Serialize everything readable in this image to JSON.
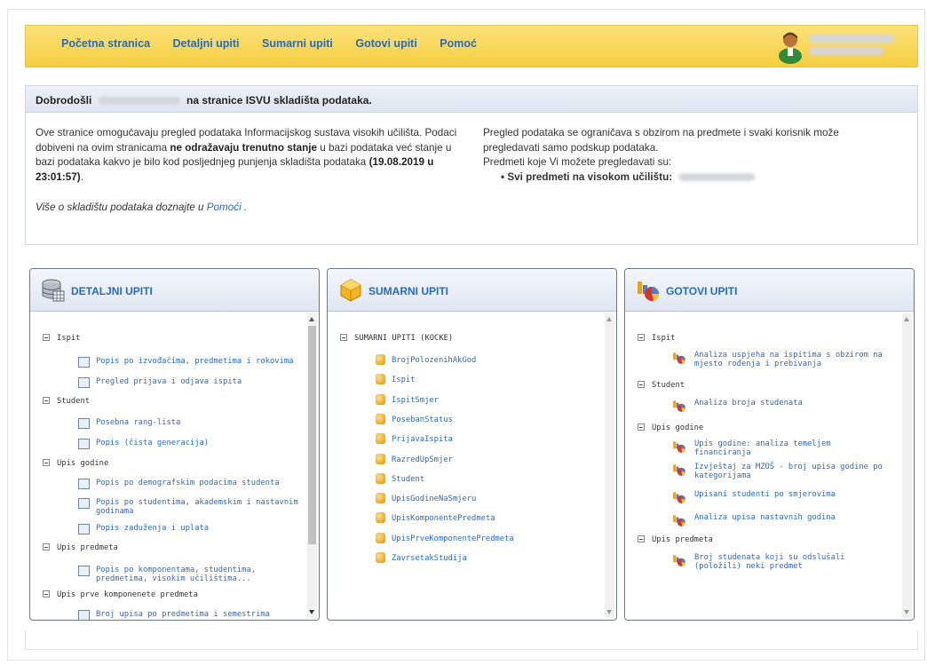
{
  "nav": {
    "links": [
      "Početna stranica",
      "Detaljni upiti",
      "Sumarni upiti",
      "Gotovi upiti",
      "Pomoć"
    ]
  },
  "welcome": {
    "title_prefix": "Dobrodošli",
    "title_suffix": "na stranice ISVU skladišta podataka.",
    "left_text_1": "Ove stranice omogućavaju pregled podataka Informacijskog sustava visokih učilišta. Podaci dobiveni na ovim stranicama",
    "left_bold": "ne odražavaju trenutno stanje",
    "left_text_2": "u bazi podataka već stanje u bazi podataka kakvo je bilo kod posljednjeg punjenja skladišta podataka",
    "left_date": "(19.08.2019 u 23:01:57)",
    "left_period": ".",
    "more_text": "Više o skladištu podataka doznajte u",
    "more_link": "Pomoći",
    "more_end": ".",
    "right_text_1": "Pregled podataka se ograničava s obzirom na predmete i svaki korisnik može pregledavati samo podskup podataka.",
    "right_text_2": "Predmeti koje Vi možete pregledavati su:",
    "right_bullet": "Svi predmeti na visokom učilištu:"
  },
  "panels": {
    "detaljni": {
      "title": "DETALJNI UPITI",
      "icon": "database-icon",
      "rows": [
        {
          "type": "group",
          "label": "Ispit"
        },
        {
          "type": "leaf",
          "label": "Popis po izvođačima, predmetima i rokovima"
        },
        {
          "type": "leaf",
          "label": "Pregled prijava i odjava ispita"
        },
        {
          "type": "group",
          "label": "Student"
        },
        {
          "type": "leaf",
          "label": "Posebna rang-lista"
        },
        {
          "type": "leaf",
          "label": "Popis (čista generacija)"
        },
        {
          "type": "group",
          "label": "Upis godine"
        },
        {
          "type": "leaf",
          "label": "Popis po demografskim podacima studenta"
        },
        {
          "type": "leaf",
          "label": "Popis po studentima, akademskim i nastavnim godinama"
        },
        {
          "type": "leaf",
          "label": "Popis zaduženja i uplata"
        },
        {
          "type": "group",
          "label": "Upis predmeta"
        },
        {
          "type": "leaf",
          "label": "Popis po komponentama, studentima, predmetima, visokim učilištima..."
        },
        {
          "type": "group",
          "label": "Upis prve komponenete predmeta"
        },
        {
          "type": "leaf",
          "label": "Broj upisa po predmetima i  semestrima"
        }
      ]
    },
    "sumarni": {
      "title": "SUMARNI UPITI",
      "icon": "cube-icon",
      "root": "SUMARNI UPITI (KOCKE)",
      "items": [
        "BrojPolozenihAkGod",
        "Ispit",
        "IspitSmjer",
        "PosebanStatus",
        "PrijavaIspita",
        "RazredUpSmjer",
        "Student",
        "UpisGodineNaSmjeru",
        "UpisKomponentePredmeta",
        "UpisPrveKomponentePredmeta",
        "ZavrsetakStudija"
      ]
    },
    "gotovi": {
      "title": "GOTOVI UPITI",
      "icon": "chart-icon",
      "rows": [
        {
          "type": "group",
          "label": "Ispit"
        },
        {
          "type": "leaf",
          "label": "Analiza uspjeha na ispitima s obzirom na mjesto rođenja i prebivanja"
        },
        {
          "type": "group",
          "label": "Student"
        },
        {
          "type": "leaf",
          "label": "Analiza broja studenata"
        },
        {
          "type": "group",
          "label": "Upis godine"
        },
        {
          "type": "leaf",
          "label": "Upis godine: analiza temeljem financiranja"
        },
        {
          "type": "leaf",
          "label": "Izvještaj za MZOŠ - broj upisa godine po kategorijama"
        },
        {
          "type": "leaf",
          "label": "Upisani studenti po smjerovima"
        },
        {
          "type": "leaf",
          "label": "Analiza upisa nastavnih godina"
        },
        {
          "type": "group",
          "label": "Upis predmeta"
        },
        {
          "type": "leaf",
          "label": "Broj studenata koji su odslušali (položili) neki predmet"
        }
      ]
    }
  }
}
